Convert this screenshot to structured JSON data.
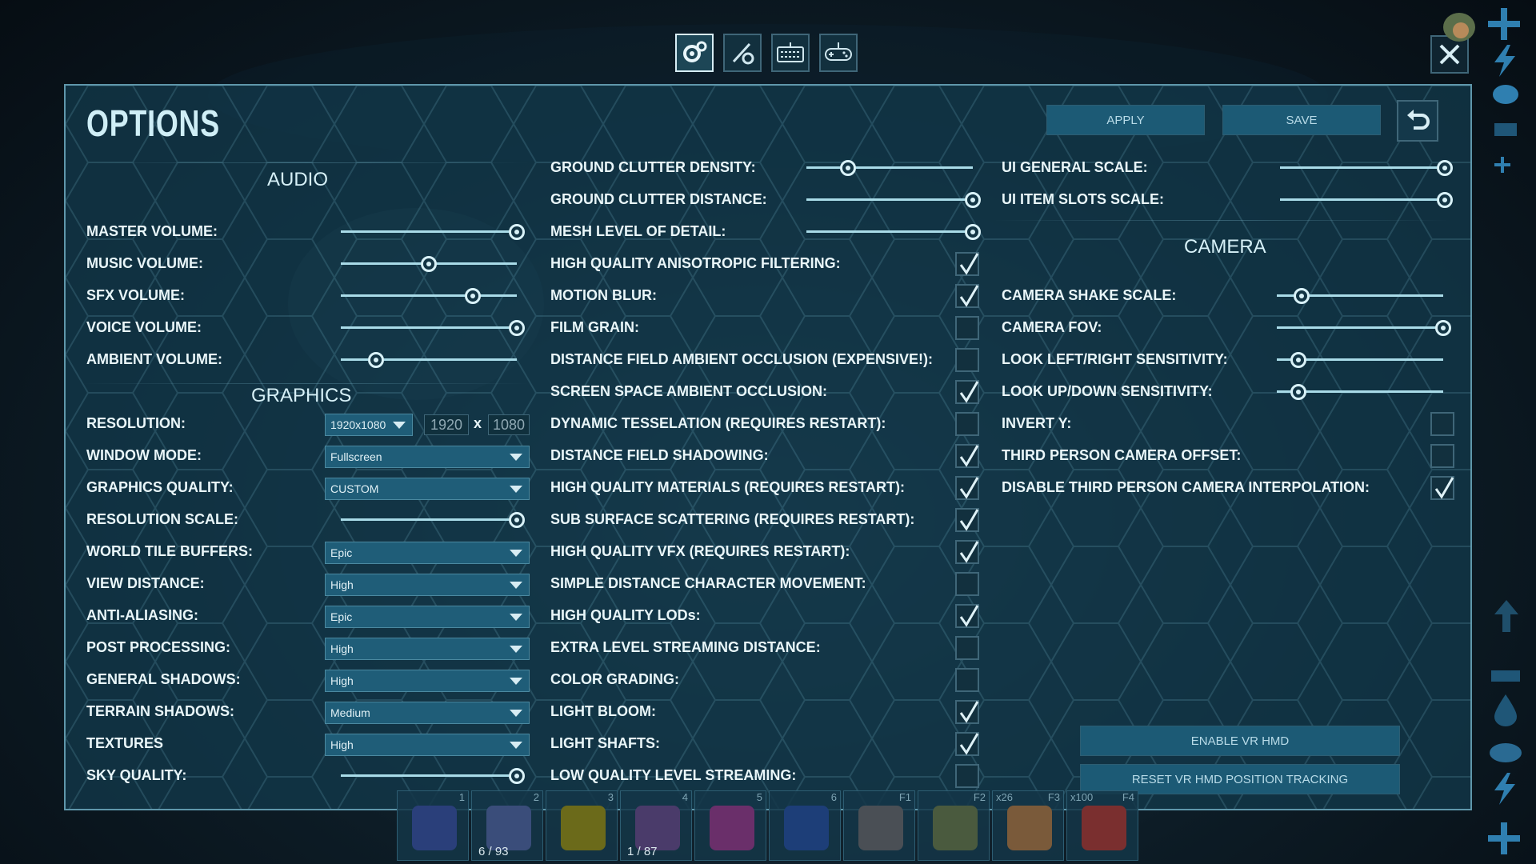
{
  "tabs": [
    {
      "name": "gear-settings-icon",
      "active": true
    },
    {
      "name": "tool-settings-icon",
      "active": false
    },
    {
      "name": "keyboard-icon",
      "active": false
    },
    {
      "name": "gamepad-icon",
      "active": false
    }
  ],
  "title": "OPTIONS",
  "buttons": {
    "apply": "APPLY",
    "save": "SAVE"
  },
  "audio": {
    "heading": "AUDIO",
    "master": "MASTER VOLUME:",
    "music": "MUSIC VOLUME:",
    "sfx": "SFX VOLUME:",
    "voice": "VOICE VOLUME:",
    "ambient": "AMBIENT VOLUME:",
    "levels": {
      "master": 1.0,
      "music": 0.5,
      "sfx": 0.75,
      "voice": 1.0,
      "ambient": 0.2
    }
  },
  "graphics": {
    "heading": "GRAPHICS",
    "resolution": "RESOLUTION:",
    "resolution_value": "1920x1080",
    "res_w": "1920",
    "res_x": "x",
    "res_h": "1080",
    "window_mode": "WINDOW MODE:",
    "window_mode_value": "Fullscreen",
    "quality": "GRAPHICS QUALITY:",
    "quality_value": "CUSTOM",
    "res_scale": "RESOLUTION SCALE:",
    "res_scale_level": 1.0,
    "world_tile": "WORLD TILE BUFFERS:",
    "world_tile_value": "Epic",
    "view_distance": "VIEW DISTANCE:",
    "view_distance_value": "High",
    "anti_aliasing": "ANTI-ALIASING:",
    "anti_aliasing_value": "Epic",
    "post_processing": "POST PROCESSING:",
    "post_processing_value": "High",
    "general_shadows": "GENERAL SHADOWS:",
    "general_shadows_value": "High",
    "terrain_shadows": "TERRAIN SHADOWS:",
    "terrain_shadows_value": "Medium",
    "textures": "TEXTURES",
    "textures_value": "High",
    "sky_quality": "SKY QUALITY:",
    "sky_quality_level": 1.0
  },
  "middle": {
    "ground_density": "GROUND CLUTTER DENSITY:",
    "ground_density_level": 0.25,
    "ground_distance": "GROUND CLUTTER DISTANCE:",
    "ground_distance_level": 1.0,
    "mesh_lod": "MESH LEVEL OF DETAIL:",
    "mesh_lod_level": 1.0,
    "checks": [
      {
        "label": "HIGH QUALITY ANISOTROPIC FILTERING:",
        "checked": true
      },
      {
        "label": "MOTION BLUR:",
        "checked": true
      },
      {
        "label": "FILM GRAIN:",
        "checked": false
      },
      {
        "label": "DISTANCE FIELD AMBIENT OCCLUSION (EXPENSIVE!):",
        "checked": false
      },
      {
        "label": "SCREEN SPACE AMBIENT OCCLUSION:",
        "checked": true
      },
      {
        "label": "DYNAMIC TESSELATION (REQUIRES RESTART):",
        "checked": false
      },
      {
        "label": "DISTANCE FIELD SHADOWING:",
        "checked": true
      },
      {
        "label": "HIGH QUALITY MATERIALS (REQUIRES RESTART):",
        "checked": true
      },
      {
        "label": "SUB SURFACE SCATTERING (REQUIRES RESTART):",
        "checked": true
      },
      {
        "label": "HIGH QUALITY VFX (REQUIRES RESTART):",
        "checked": true
      },
      {
        "label": "SIMPLE DISTANCE CHARACTER MOVEMENT:",
        "checked": false
      },
      {
        "label": "HIGH QUALITY LODs:",
        "checked": true
      },
      {
        "label": "EXTRA LEVEL STREAMING DISTANCE:",
        "checked": false
      },
      {
        "label": "COLOR GRADING:",
        "checked": false
      },
      {
        "label": "LIGHT BLOOM:",
        "checked": true
      },
      {
        "label": "LIGHT SHAFTS:",
        "checked": true
      },
      {
        "label": "LOW QUALITY LEVEL STREAMING:",
        "checked": false
      }
    ]
  },
  "right": {
    "ui_general": "UI GENERAL SCALE:",
    "ui_general_level": 1.0,
    "ui_item": "UI ITEM SLOTS SCALE:",
    "ui_item_level": 1.0,
    "camera_heading": "CAMERA",
    "shake": "CAMERA SHAKE SCALE:",
    "shake_level": 0.15,
    "fov": "CAMERA FOV:",
    "fov_level": 1.0,
    "look_lr": "LOOK LEFT/RIGHT SENSITIVITY:",
    "look_lr_level": 0.13,
    "look_ud": "LOOK UP/DOWN SENSITIVITY:",
    "look_ud_level": 0.13,
    "invert_y": "INVERT Y:",
    "invert_y_checked": false,
    "third_offset": "THIRD PERSON CAMERA OFFSET:",
    "third_offset_checked": false,
    "disable_interp": "DISABLE THIRD PERSON CAMERA INTERPOLATION:",
    "disable_interp_checked": true,
    "vr_enable": "ENABLE VR HMD",
    "vr_reset": "RESET VR HMD POSITION TRACKING"
  },
  "hotbar": [
    {
      "num": "1",
      "qty": "",
      "count": "",
      "color": "#2a3f7a"
    },
    {
      "num": "2",
      "qty": "",
      "count": "6 / 93",
      "color": "#3a4d7a"
    },
    {
      "num": "3",
      "qty": "",
      "count": "",
      "color": "#6b6a1a"
    },
    {
      "num": "4",
      "qty": "",
      "count": "1 / 87",
      "color": "#4a3b6a"
    },
    {
      "num": "5",
      "qty": "",
      "count": "",
      "color": "#6a2f6a"
    },
    {
      "num": "6",
      "qty": "",
      "count": "",
      "color": "#1d3e78"
    },
    {
      "num": "F1",
      "qty": "",
      "count": "",
      "color": "#4a4f55"
    },
    {
      "num": "F2",
      "qty": "",
      "count": "",
      "color": "#4a5a3e"
    },
    {
      "num": "F3",
      "qty": "x26",
      "count": "",
      "color": "#7a5a3a"
    },
    {
      "num": "F4",
      "qty": "x100",
      "count": "",
      "color": "#7a2f2f"
    }
  ],
  "colors": {
    "accent": "#5f97ab",
    "panel": "#12384a",
    "button": "#1c5a75",
    "side_icons": "#2f7fb0"
  }
}
